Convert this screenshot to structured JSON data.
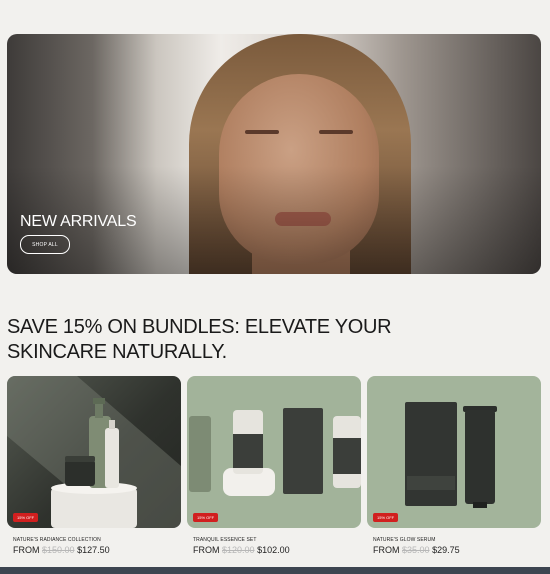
{
  "hero": {
    "title": "NEW ARRIVALS",
    "button_label": "SHOP ALL"
  },
  "section": {
    "title": "SAVE 15% ON BUNDLES: ELEVATE YOUR SKINCARE NATURALLY."
  },
  "colors": {
    "page_bg": "#f2f1ee",
    "badge": "#d11f1f",
    "sage": "#a1b39a",
    "dark_product": "#3b3e3a"
  },
  "products": [
    {
      "badge": "15% OFF",
      "name": "NATURE'S RADIANCE COLLECTION",
      "from": "FROM",
      "old_price": "$150.00",
      "price": "$127.50"
    },
    {
      "badge": "15% OFF",
      "name": "TRANQUIL ESSENCE SET",
      "from": "FROM",
      "old_price": "$120.00",
      "price": "$102.00"
    },
    {
      "badge": "15% OFF",
      "name": "NATURE'S GLOW SERUM",
      "from": "FROM",
      "old_price": "$35.00",
      "price": "$29.75"
    }
  ]
}
